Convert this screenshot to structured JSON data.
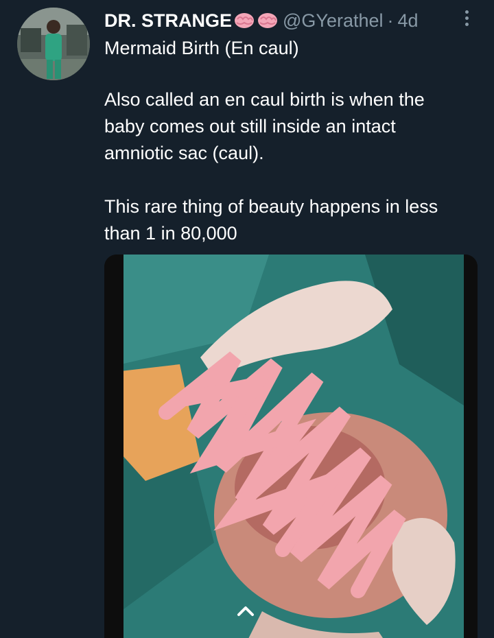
{
  "tweet": {
    "display_name": "DR. STRANGE",
    "name_emoji": [
      "brain-emoji",
      "brain-emoji"
    ],
    "handle": "@GYerathel",
    "separator": "·",
    "time": "4d",
    "lines": [
      "Mermaid Birth (En caul)",
      "",
      "Also called an en caul birth is when the",
      "baby comes out still inside an intact",
      "amniotic sac (caul).",
      "",
      "This rare thing of beauty happens in less",
      "than 1 in 80,000"
    ]
  },
  "icons": {
    "more": "more-vertical-icon",
    "scroll": "chevron-up-icon"
  },
  "colors": {
    "background": "#15202b",
    "secondary_text": "#8899a6",
    "primary_text": "#ffffff"
  }
}
